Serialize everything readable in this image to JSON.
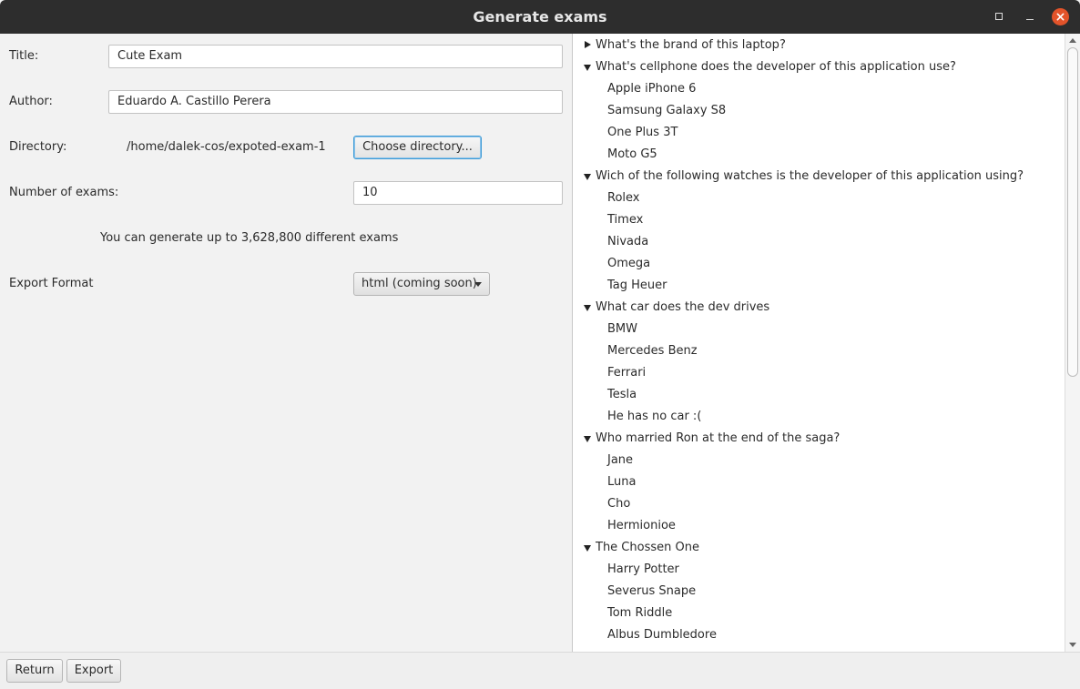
{
  "window": {
    "title": "Generate exams"
  },
  "form": {
    "title_label": "Title:",
    "title_value": "Cute Exam",
    "author_label": "Author:",
    "author_value": "Eduardo A. Castillo Perera",
    "directory_label": "Directory:",
    "directory_value": "/home/dalek-cos/expoted-exam-1",
    "choose_directory_label": "Choose directory...",
    "num_exams_label": "Number of exams:",
    "num_exams_value": "10",
    "info_text": "You can generate up to 3,628,800 different exams",
    "export_format_label": "Export Format",
    "export_format_value": "html (coming soon)"
  },
  "tree": {
    "rows": [
      {
        "type": "question",
        "expanded": false,
        "text": "What's the brand of this laptop?"
      },
      {
        "type": "question",
        "expanded": true,
        "text": "What's cellphone does the developer of this application use?"
      },
      {
        "type": "answer",
        "text": "Apple iPhone 6"
      },
      {
        "type": "answer",
        "text": "Samsung Galaxy S8"
      },
      {
        "type": "answer",
        "text": "One Plus 3T"
      },
      {
        "type": "answer",
        "text": "Moto G5"
      },
      {
        "type": "question",
        "expanded": true,
        "text": "Wich of the following watches is the developer of this application using?"
      },
      {
        "type": "answer",
        "text": "Rolex"
      },
      {
        "type": "answer",
        "text": "Timex"
      },
      {
        "type": "answer",
        "text": "Nivada"
      },
      {
        "type": "answer",
        "text": "Omega"
      },
      {
        "type": "answer",
        "text": "Tag Heuer"
      },
      {
        "type": "question",
        "expanded": true,
        "text": "What car does the dev drives"
      },
      {
        "type": "answer",
        "text": "BMW"
      },
      {
        "type": "answer",
        "text": "Mercedes Benz"
      },
      {
        "type": "answer",
        "text": "Ferrari"
      },
      {
        "type": "answer",
        "text": "Tesla"
      },
      {
        "type": "answer",
        "text": "He has no car :("
      },
      {
        "type": "question",
        "expanded": true,
        "text": "Who married Ron at the end of the saga?"
      },
      {
        "type": "answer",
        "text": "Jane"
      },
      {
        "type": "answer",
        "text": "Luna"
      },
      {
        "type": "answer",
        "text": "Cho"
      },
      {
        "type": "answer",
        "text": "Hermionioe"
      },
      {
        "type": "question",
        "expanded": true,
        "text": "The Chossen One"
      },
      {
        "type": "answer",
        "text": "Harry Potter"
      },
      {
        "type": "answer",
        "text": "Severus Snape"
      },
      {
        "type": "answer",
        "text": "Tom Riddle"
      },
      {
        "type": "answer",
        "text": "Albus Dumbledore"
      }
    ]
  },
  "footer": {
    "return_label": "Return",
    "export_label": "Export"
  },
  "colors": {
    "titlebar": "#2d2d2d",
    "close_button": "#e2532a",
    "focus": "#3c9ad6"
  }
}
